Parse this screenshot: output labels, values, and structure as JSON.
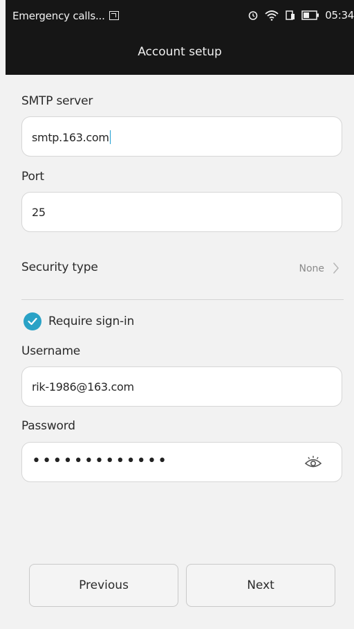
{
  "status_bar": {
    "carrier": "Emergency calls...",
    "time": "05:34",
    "icons": [
      "image-notification-icon",
      "alarm-icon",
      "wifi-icon",
      "sim-icon",
      "battery-icon"
    ]
  },
  "header": {
    "title": "Account setup"
  },
  "form": {
    "smtp_label": "SMTP server",
    "smtp_value": "smtp.163.com",
    "port_label": "Port",
    "port_value": "25",
    "security_label": "Security type",
    "security_value": "None",
    "require_signin_label": "Require sign-in",
    "require_signin_checked": true,
    "username_label": "Username",
    "username_value": "rik-1986@163.com",
    "password_label": "Password",
    "password_masked": "•••••••••••••"
  },
  "buttons": {
    "previous": "Previous",
    "next": "Next"
  },
  "colors": {
    "accent": "#2aa2c6",
    "header_bg": "#161616",
    "page_bg": "#f2f2f2"
  }
}
